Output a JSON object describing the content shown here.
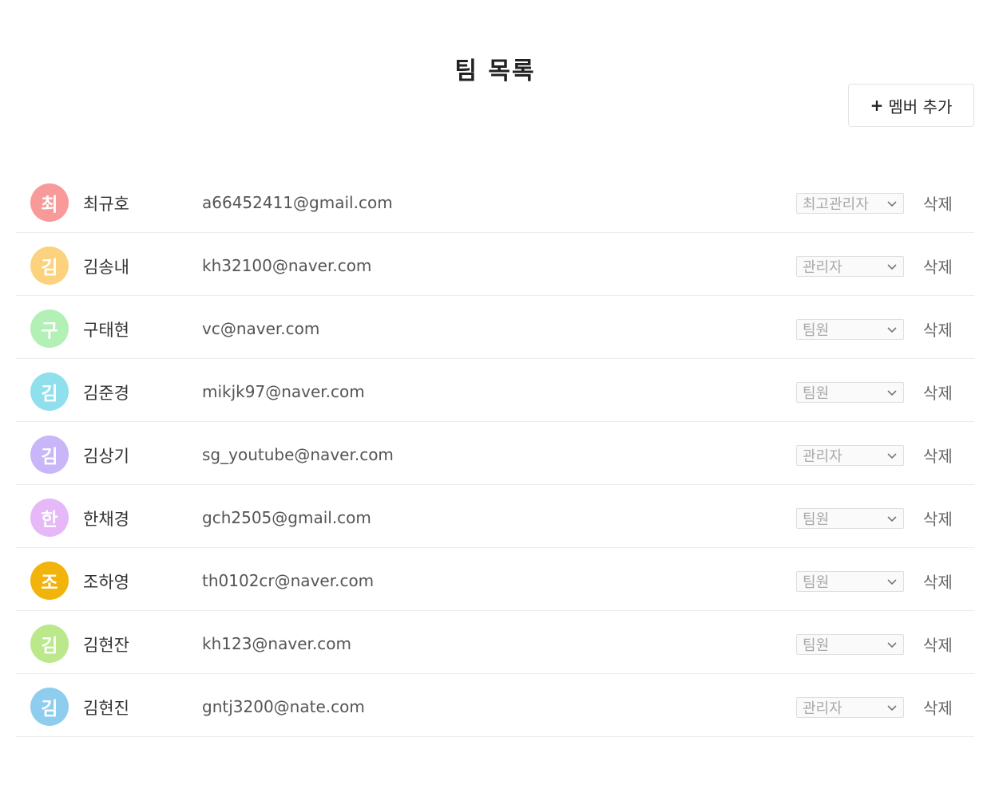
{
  "page": {
    "title": "팀 목록"
  },
  "toolbar": {
    "add_plus": "+",
    "add_label": "멤버 추가"
  },
  "members": [
    {
      "initial": "최",
      "name": "최규호",
      "email": "a66452411@gmail.com",
      "role": "최고관리자",
      "delete_label": "삭제",
      "color": "#f99a9a"
    },
    {
      "initial": "김",
      "name": "김송내",
      "email": "kh32100@naver.com",
      "role": "관리자",
      "delete_label": "삭제",
      "color": "#fdd27f"
    },
    {
      "initial": "구",
      "name": "구태현",
      "email": "vc@naver.com",
      "role": "팀원",
      "delete_label": "삭제",
      "color": "#b3f0b6"
    },
    {
      "initial": "김",
      "name": "김준경",
      "email": "mikjk97@naver.com",
      "role": "팀원",
      "delete_label": "삭제",
      "color": "#8fe0ec"
    },
    {
      "initial": "김",
      "name": "김상기",
      "email": "sg_youtube@naver.com",
      "role": "관리자",
      "delete_label": "삭제",
      "color": "#c8b6f8"
    },
    {
      "initial": "한",
      "name": "한채경",
      "email": "gch2505@gmail.com",
      "role": "팀원",
      "delete_label": "삭제",
      "color": "#e6b8f8"
    },
    {
      "initial": "조",
      "name": "조하영",
      "email": "th0102cr@naver.com",
      "role": "팀원",
      "delete_label": "삭제",
      "color": "#f2b40b"
    },
    {
      "initial": "김",
      "name": "김현잔",
      "email": "kh123@naver.com",
      "role": "팀원",
      "delete_label": "삭제",
      "color": "#bbe88a"
    },
    {
      "initial": "김",
      "name": "김현진",
      "email": "gntj3200@nate.com",
      "role": "관리자",
      "delete_label": "삭제",
      "color": "#8fcdef"
    }
  ]
}
